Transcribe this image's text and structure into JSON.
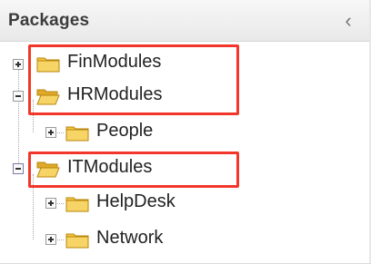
{
  "panel": {
    "title": "Packages",
    "collapse_glyph": "‹"
  },
  "tree": {
    "fin": {
      "label": "FinModules",
      "state": "collapsed",
      "icon": "folder-closed-icon"
    },
    "hr": {
      "label": "HRModules",
      "state": "expanded",
      "icon": "folder-open-icon"
    },
    "people": {
      "label": "People",
      "state": "collapsed",
      "icon": "folder-closed-icon"
    },
    "it": {
      "label": "ITModules",
      "state": "expanded",
      "icon": "folder-open-icon"
    },
    "helpdesk": {
      "label": "HelpDesk",
      "state": "collapsed",
      "icon": "folder-closed-icon"
    },
    "network": {
      "label": "Network",
      "state": "collapsed",
      "icon": "folder-closed-icon"
    }
  },
  "colors": {
    "highlight": "#f2372a",
    "folder_fill": "#f4c542",
    "folder_stroke": "#b8860b"
  }
}
